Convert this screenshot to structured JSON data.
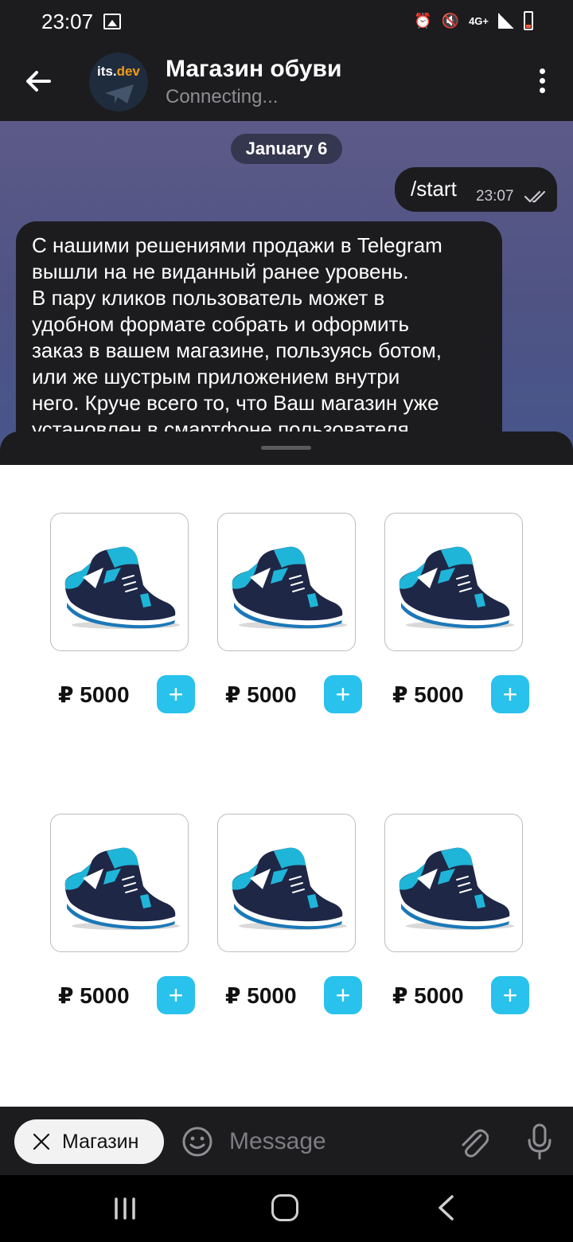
{
  "status_bar": {
    "time": "23:07",
    "network": "4G+"
  },
  "header": {
    "avatar_text_a": "its.",
    "avatar_text_b": "dev",
    "title": "Магазин обуви",
    "subtitle": "Connecting..."
  },
  "chat": {
    "date": "January 6",
    "outgoing": {
      "text": "/start",
      "time": "23:07"
    },
    "incoming": {
      "text": "С нашими решениями продажи в Telegram\nвышли на не виданный ранее уровень.\nВ пару кликов пользователь может в\nудобном формате собрать и оформить\nзаказ в вашем магазине, пользуясь ботом,\nили же шустрым приложением внутри\nнего. Круче всего то, что Ваш магазин уже\nустановлен в смартфоне пользователя"
    }
  },
  "products": [
    {
      "price": "₽ 5000",
      "add_label": "+"
    },
    {
      "price": "₽ 5000",
      "add_label": "+"
    },
    {
      "price": "₽ 5000",
      "add_label": "+"
    },
    {
      "price": "₽ 5000",
      "add_label": "+"
    },
    {
      "price": "₽ 5000",
      "add_label": "+"
    },
    {
      "price": "₽ 5000",
      "add_label": "+"
    }
  ],
  "input_bar": {
    "shop_chip_label": "Магазин",
    "message_placeholder": "Message"
  },
  "colors": {
    "accent": "#28c2ec",
    "shoe_blue": "#1fb5d8",
    "shoe_navy": "#1f2747"
  }
}
